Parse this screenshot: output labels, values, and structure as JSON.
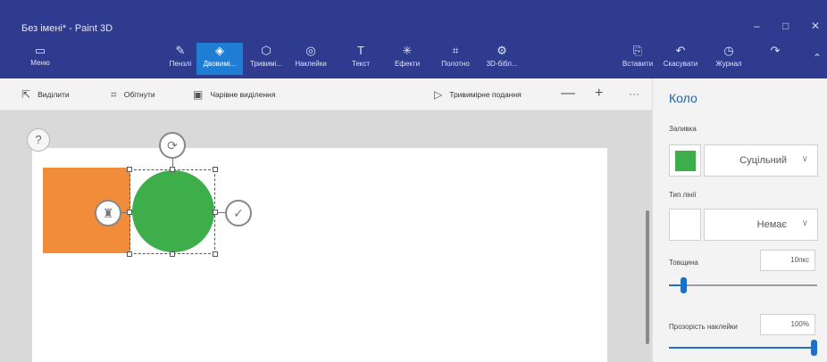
{
  "window": {
    "title": "Без імені* - Paint 3D",
    "controls": [
      "–",
      "□",
      "✕"
    ]
  },
  "ribbon": {
    "menu": {
      "label": "Меню",
      "icon": "folder-icon"
    },
    "tools": [
      {
        "label": "Пензлі",
        "icon": "brush-icon",
        "active": false
      },
      {
        "label": "Двовимі...",
        "icon": "2d-shapes-icon",
        "active": true
      },
      {
        "label": "Тривимі...",
        "icon": "3d-shapes-icon",
        "active": false
      },
      {
        "label": "Наклейки",
        "icon": "stickers-icon",
        "active": false
      },
      {
        "label": "Текст",
        "icon": "text-icon",
        "active": false
      },
      {
        "label": "Ефекти",
        "icon": "effects-icon",
        "active": false
      },
      {
        "label": "Полотно",
        "icon": "canvas-icon",
        "active": false
      },
      {
        "label": "3D-бібл...",
        "icon": "3d-library-icon",
        "active": false
      }
    ],
    "right_tools": [
      {
        "label": "Вставити",
        "icon": "paste-icon"
      },
      {
        "label": "Скасувати",
        "icon": "undo-icon"
      },
      {
        "label": "Журнал",
        "icon": "history-icon"
      },
      {
        "label": "",
        "icon": "redo-icon"
      }
    ]
  },
  "toolbar": {
    "select": "Виділити",
    "crop": "Обітнути",
    "magic_select": "Чарівне виділення",
    "view_3d": "Тривимірне подання",
    "zoom_out": "—",
    "zoom_in": "+",
    "more": "···"
  },
  "canvas": {
    "help": "?",
    "shape_fill_color": "#3dae49",
    "rect_color": "#f08c3a"
  },
  "panel": {
    "title": "Коло",
    "fill_label": "Заливка",
    "fill_color": "#3dae49",
    "fill_type": "Суцільний",
    "line_label": "Тип лінії",
    "line_type": "Немає",
    "thickness_label": "Товщина",
    "thickness_value": "10пкс",
    "thickness_fraction": 0.1,
    "opacity_label": "Прозорість наклейки",
    "opacity_value": "100%",
    "opacity_fraction": 1.0
  }
}
